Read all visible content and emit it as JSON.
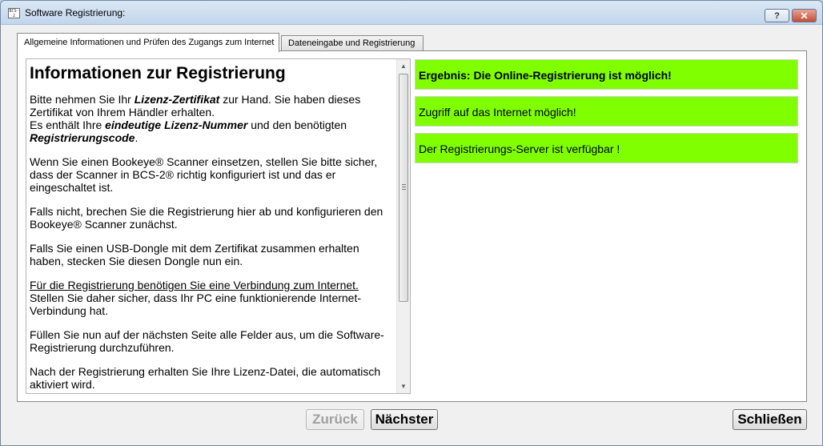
{
  "window": {
    "title": "Software Registrierung:",
    "app_icon_text": "BCS-2",
    "help_label": "?",
    "close_label": "✕"
  },
  "tabs": [
    {
      "label": "Allgemeine Informationen und Prüfen des Zugangs zum Internet",
      "active": true
    },
    {
      "label": "Dateneingabe und Registrierung",
      "active": false
    }
  ],
  "info": {
    "heading": "Informationen zur Registrierung",
    "p1_a": "Bitte nehmen Sie Ihr ",
    "p1_b": "Lizenz-Zertifikat",
    "p1_c": " zur Hand. Sie haben dieses Zertifikat von Ihrem Händler erhalten.",
    "p1_d": "Es enthält Ihre ",
    "p1_e": "eindeutige Lizenz-Nummer",
    "p1_f": " und den benötigten ",
    "p1_g": "Registrierungscode",
    "p1_h": ".",
    "p2": "Wenn Sie einen Bookeye® Scanner einsetzen, stellen Sie bitte sicher, dass der Scanner in BCS-2® richtig konfiguriert ist und das er eingeschaltet ist.",
    "p3": "Falls nicht, brechen Sie die Registrierung hier ab und konfigurieren den Bookeye® Scanner zunächst.",
    "p4": "Falls Sie einen USB-Dongle mit dem Zertifikat zusammen erhalten haben, stecken Sie diesen Dongle nun ein.",
    "p5_a": "Für die Registrierung benötigen Sie eine Verbindung zum Internet.",
    "p5_b": "Stellen Sie daher sicher, dass Ihr PC eine funktionierende Internet-Verbindung hat.",
    "p6": "Füllen Sie nun auf der nächsten Seite alle Felder aus, um die Software-Registrierung durchzuführen.",
    "p7": "Nach der Registrierung erhalten Sie Ihre Lizenz-Datei, die automatisch aktiviert wird."
  },
  "status": [
    {
      "text": "Ergebnis: Die Online-Registrierung ist möglich!",
      "bold": true
    },
    {
      "text": "Zugriff auf das Internet möglich!",
      "bold": false
    },
    {
      "text": "Der Registrierungs-Server ist verfügbar !",
      "bold": false
    }
  ],
  "status_color": "#80ff00",
  "buttons": {
    "back": "Zurück",
    "next": "Nächster",
    "close": "Schließen"
  }
}
